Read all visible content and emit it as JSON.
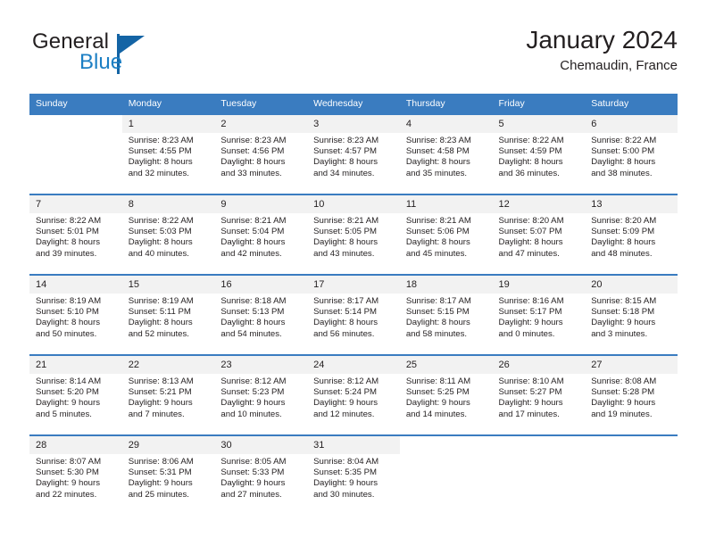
{
  "brand": {
    "word1": "General",
    "word2": "Blue",
    "logo_icon": "triangle-flag-icon",
    "accent_color": "#1464a5",
    "blue_text_color": "#1c7fc4"
  },
  "header": {
    "title": "January 2024",
    "location": "Chemaudin, France"
  },
  "calendar": {
    "header_bg": "#3a7cc0",
    "daynum_bg": "#f2f2f2",
    "weekdays": [
      "Sunday",
      "Monday",
      "Tuesday",
      "Wednesday",
      "Thursday",
      "Friday",
      "Saturday"
    ],
    "weeks": [
      [
        {
          "day": "",
          "sunrise": "",
          "sunset": "",
          "daylight_line1": "",
          "daylight_line2": ""
        },
        {
          "day": "1",
          "sunrise": "Sunrise: 8:23 AM",
          "sunset": "Sunset: 4:55 PM",
          "daylight_line1": "Daylight: 8 hours",
          "daylight_line2": "and 32 minutes."
        },
        {
          "day": "2",
          "sunrise": "Sunrise: 8:23 AM",
          "sunset": "Sunset: 4:56 PM",
          "daylight_line1": "Daylight: 8 hours",
          "daylight_line2": "and 33 minutes."
        },
        {
          "day": "3",
          "sunrise": "Sunrise: 8:23 AM",
          "sunset": "Sunset: 4:57 PM",
          "daylight_line1": "Daylight: 8 hours",
          "daylight_line2": "and 34 minutes."
        },
        {
          "day": "4",
          "sunrise": "Sunrise: 8:23 AM",
          "sunset": "Sunset: 4:58 PM",
          "daylight_line1": "Daylight: 8 hours",
          "daylight_line2": "and 35 minutes."
        },
        {
          "day": "5",
          "sunrise": "Sunrise: 8:22 AM",
          "sunset": "Sunset: 4:59 PM",
          "daylight_line1": "Daylight: 8 hours",
          "daylight_line2": "and 36 minutes."
        },
        {
          "day": "6",
          "sunrise": "Sunrise: 8:22 AM",
          "sunset": "Sunset: 5:00 PM",
          "daylight_line1": "Daylight: 8 hours",
          "daylight_line2": "and 38 minutes."
        }
      ],
      [
        {
          "day": "7",
          "sunrise": "Sunrise: 8:22 AM",
          "sunset": "Sunset: 5:01 PM",
          "daylight_line1": "Daylight: 8 hours",
          "daylight_line2": "and 39 minutes."
        },
        {
          "day": "8",
          "sunrise": "Sunrise: 8:22 AM",
          "sunset": "Sunset: 5:03 PM",
          "daylight_line1": "Daylight: 8 hours",
          "daylight_line2": "and 40 minutes."
        },
        {
          "day": "9",
          "sunrise": "Sunrise: 8:21 AM",
          "sunset": "Sunset: 5:04 PM",
          "daylight_line1": "Daylight: 8 hours",
          "daylight_line2": "and 42 minutes."
        },
        {
          "day": "10",
          "sunrise": "Sunrise: 8:21 AM",
          "sunset": "Sunset: 5:05 PM",
          "daylight_line1": "Daylight: 8 hours",
          "daylight_line2": "and 43 minutes."
        },
        {
          "day": "11",
          "sunrise": "Sunrise: 8:21 AM",
          "sunset": "Sunset: 5:06 PM",
          "daylight_line1": "Daylight: 8 hours",
          "daylight_line2": "and 45 minutes."
        },
        {
          "day": "12",
          "sunrise": "Sunrise: 8:20 AM",
          "sunset": "Sunset: 5:07 PM",
          "daylight_line1": "Daylight: 8 hours",
          "daylight_line2": "and 47 minutes."
        },
        {
          "day": "13",
          "sunrise": "Sunrise: 8:20 AM",
          "sunset": "Sunset: 5:09 PM",
          "daylight_line1": "Daylight: 8 hours",
          "daylight_line2": "and 48 minutes."
        }
      ],
      [
        {
          "day": "14",
          "sunrise": "Sunrise: 8:19 AM",
          "sunset": "Sunset: 5:10 PM",
          "daylight_line1": "Daylight: 8 hours",
          "daylight_line2": "and 50 minutes."
        },
        {
          "day": "15",
          "sunrise": "Sunrise: 8:19 AM",
          "sunset": "Sunset: 5:11 PM",
          "daylight_line1": "Daylight: 8 hours",
          "daylight_line2": "and 52 minutes."
        },
        {
          "day": "16",
          "sunrise": "Sunrise: 8:18 AM",
          "sunset": "Sunset: 5:13 PM",
          "daylight_line1": "Daylight: 8 hours",
          "daylight_line2": "and 54 minutes."
        },
        {
          "day": "17",
          "sunrise": "Sunrise: 8:17 AM",
          "sunset": "Sunset: 5:14 PM",
          "daylight_line1": "Daylight: 8 hours",
          "daylight_line2": "and 56 minutes."
        },
        {
          "day": "18",
          "sunrise": "Sunrise: 8:17 AM",
          "sunset": "Sunset: 5:15 PM",
          "daylight_line1": "Daylight: 8 hours",
          "daylight_line2": "and 58 minutes."
        },
        {
          "day": "19",
          "sunrise": "Sunrise: 8:16 AM",
          "sunset": "Sunset: 5:17 PM",
          "daylight_line1": "Daylight: 9 hours",
          "daylight_line2": "and 0 minutes."
        },
        {
          "day": "20",
          "sunrise": "Sunrise: 8:15 AM",
          "sunset": "Sunset: 5:18 PM",
          "daylight_line1": "Daylight: 9 hours",
          "daylight_line2": "and 3 minutes."
        }
      ],
      [
        {
          "day": "21",
          "sunrise": "Sunrise: 8:14 AM",
          "sunset": "Sunset: 5:20 PM",
          "daylight_line1": "Daylight: 9 hours",
          "daylight_line2": "and 5 minutes."
        },
        {
          "day": "22",
          "sunrise": "Sunrise: 8:13 AM",
          "sunset": "Sunset: 5:21 PM",
          "daylight_line1": "Daylight: 9 hours",
          "daylight_line2": "and 7 minutes."
        },
        {
          "day": "23",
          "sunrise": "Sunrise: 8:12 AM",
          "sunset": "Sunset: 5:23 PM",
          "daylight_line1": "Daylight: 9 hours",
          "daylight_line2": "and 10 minutes."
        },
        {
          "day": "24",
          "sunrise": "Sunrise: 8:12 AM",
          "sunset": "Sunset: 5:24 PM",
          "daylight_line1": "Daylight: 9 hours",
          "daylight_line2": "and 12 minutes."
        },
        {
          "day": "25",
          "sunrise": "Sunrise: 8:11 AM",
          "sunset": "Sunset: 5:25 PM",
          "daylight_line1": "Daylight: 9 hours",
          "daylight_line2": "and 14 minutes."
        },
        {
          "day": "26",
          "sunrise": "Sunrise: 8:10 AM",
          "sunset": "Sunset: 5:27 PM",
          "daylight_line1": "Daylight: 9 hours",
          "daylight_line2": "and 17 minutes."
        },
        {
          "day": "27",
          "sunrise": "Sunrise: 8:08 AM",
          "sunset": "Sunset: 5:28 PM",
          "daylight_line1": "Daylight: 9 hours",
          "daylight_line2": "and 19 minutes."
        }
      ],
      [
        {
          "day": "28",
          "sunrise": "Sunrise: 8:07 AM",
          "sunset": "Sunset: 5:30 PM",
          "daylight_line1": "Daylight: 9 hours",
          "daylight_line2": "and 22 minutes."
        },
        {
          "day": "29",
          "sunrise": "Sunrise: 8:06 AM",
          "sunset": "Sunset: 5:31 PM",
          "daylight_line1": "Daylight: 9 hours",
          "daylight_line2": "and 25 minutes."
        },
        {
          "day": "30",
          "sunrise": "Sunrise: 8:05 AM",
          "sunset": "Sunset: 5:33 PM",
          "daylight_line1": "Daylight: 9 hours",
          "daylight_line2": "and 27 minutes."
        },
        {
          "day": "31",
          "sunrise": "Sunrise: 8:04 AM",
          "sunset": "Sunset: 5:35 PM",
          "daylight_line1": "Daylight: 9 hours",
          "daylight_line2": "and 30 minutes."
        },
        {
          "day": "",
          "sunrise": "",
          "sunset": "",
          "daylight_line1": "",
          "daylight_line2": ""
        },
        {
          "day": "",
          "sunrise": "",
          "sunset": "",
          "daylight_line1": "",
          "daylight_line2": ""
        },
        {
          "day": "",
          "sunrise": "",
          "sunset": "",
          "daylight_line1": "",
          "daylight_line2": ""
        }
      ]
    ]
  }
}
